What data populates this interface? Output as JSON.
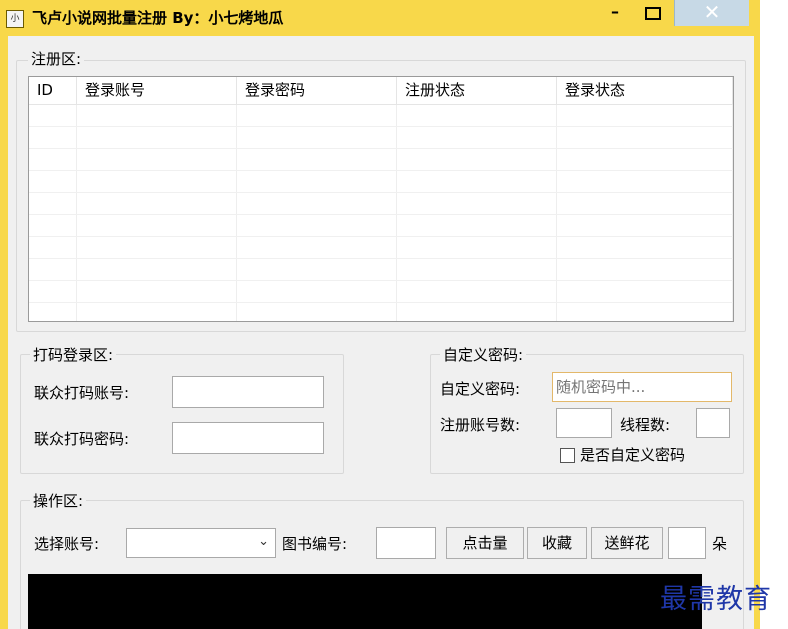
{
  "window": {
    "title": "飞卢小说网批量注册   By：小七烤地瓜",
    "icon_text": "小",
    "minimize": "–",
    "close": "✕"
  },
  "register_area": {
    "label": "注册区:",
    "columns": [
      "ID",
      "登录账号",
      "登录密码",
      "注册状态",
      "登录状态"
    ],
    "rows": []
  },
  "captcha_login": {
    "label": "打码登录区:",
    "account_label": "联众打码账号:",
    "account_value": "",
    "password_label": "联众打码密码:",
    "password_value": ""
  },
  "custom_password": {
    "label": "自定义密码:",
    "password_label": "自定义密码:",
    "password_placeholder": "随机密码中...",
    "count_label": "注册账号数:",
    "count_value": "",
    "threads_label": "线程数:",
    "threads_value": "",
    "checkbox_label": "是否自定义密码",
    "checkbox_checked": false
  },
  "operation_area": {
    "label": "操作区:",
    "select_account_label": "选择账号:",
    "select_account_value": "",
    "book_id_label": "图书编号:",
    "book_id_value": "",
    "click_button": "点击量",
    "collect_button": "收藏",
    "flower_button": "送鲜花",
    "flower_count": "",
    "flower_unit": "朵"
  },
  "watermark": "最需教育"
}
